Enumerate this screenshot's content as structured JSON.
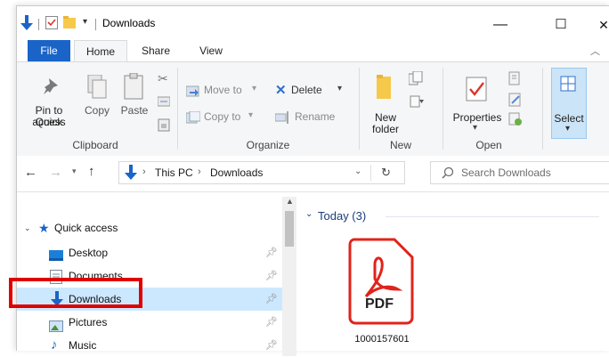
{
  "window": {
    "title": "Downloads",
    "buttons": {
      "minimize": "—",
      "maximize": "☐",
      "close": "✕"
    }
  },
  "tabs": {
    "file": "File",
    "home": "Home",
    "share": "Share",
    "view": "View"
  },
  "ribbon": {
    "clipboard": {
      "pin_line1": "Pin to Quick",
      "pin_line2": "access",
      "copy": "Copy",
      "paste": "Paste",
      "group": "Clipboard"
    },
    "organize": {
      "move_to": "Move to",
      "copy_to": "Copy to",
      "delete": "Delete",
      "rename": "Rename",
      "group": "Organize"
    },
    "new": {
      "folder_line1": "New",
      "folder_line2": "folder",
      "group": "New"
    },
    "open": {
      "properties": "Properties",
      "group": "Open"
    },
    "select": {
      "label": "Select"
    }
  },
  "address": {
    "root": "This PC",
    "current": "Downloads",
    "search_placeholder": "Search Downloads"
  },
  "nav": {
    "quick_access": "Quick access",
    "items": [
      {
        "label": "Desktop"
      },
      {
        "label": "Documents"
      },
      {
        "label": "Downloads"
      },
      {
        "label": "Pictures"
      },
      {
        "label": "Music"
      }
    ]
  },
  "content": {
    "group_header": "Today (3)",
    "files": [
      {
        "name": "1000157601",
        "badge": "PDF"
      }
    ]
  },
  "colors": {
    "accent": "#1a64c8",
    "selected": "#cce8ff",
    "pdf_red": "#e2231a",
    "highlight": "#e00000"
  }
}
